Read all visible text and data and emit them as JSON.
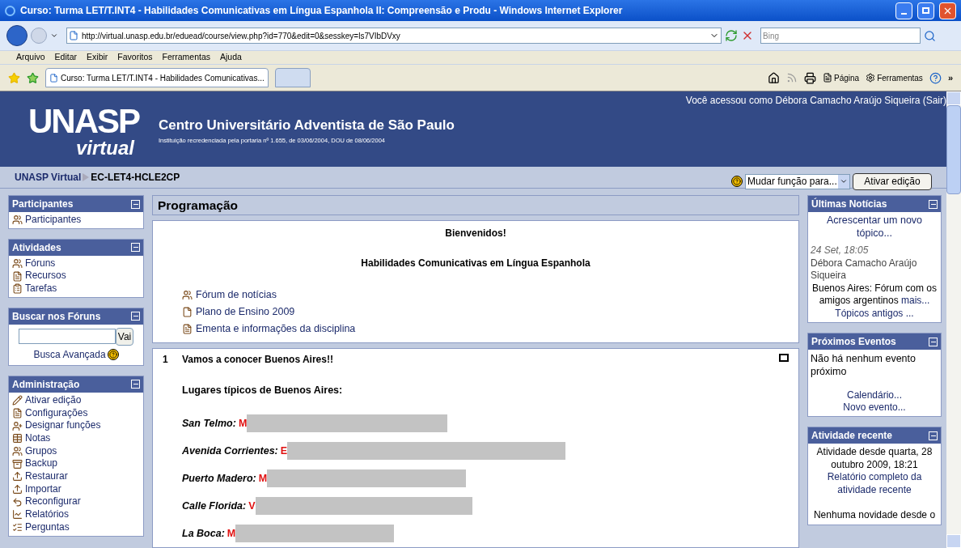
{
  "window": {
    "title": "Curso: Turma LET/T.INT4 - Habilidades Comunicativas em Língua Espanhola II: Compreensão e Produ - Windows Internet Explorer"
  },
  "address_bar": {
    "url": "http://virtual.unasp.edu.br/eduead/course/view.php?id=770&edit=0&sesskey=ls7VIbDVxy",
    "search_placeholder": "Bing"
  },
  "menu": [
    "Arquivo",
    "Editar",
    "Exibir",
    "Favoritos",
    "Ferramentas",
    "Ajuda"
  ],
  "tabs": [
    {
      "label": "Curso: Turma LET/T.INT4 - Habilidades Comunicativas...",
      "selected": true
    },
    {
      "selected": false
    }
  ],
  "command_bar": [
    "Página",
    "Ferramentas",
    "»"
  ],
  "header": {
    "logo_top": "UNASP",
    "logo_bottom": "virtual",
    "title": "Centro Universitário Adventista de São Paulo",
    "subtitle": "Instituição recredenciada pela portaria nº 1.655, de 03/06/2004, DOU de 08/06/2004",
    "login": "Você acessou como Débora Camacho Araújo Siqueira (Sair)"
  },
  "breadcrumb": {
    "items": [
      "UNASP Virtual",
      "EC-LET4-HCLE2CP"
    ],
    "role_select": "Mudar função para...",
    "edit_button": "Ativar edição"
  },
  "left_blocks": [
    {
      "title": "Participantes",
      "kind": "list",
      "items": [
        "Participantes"
      ]
    },
    {
      "title": "Atividades",
      "kind": "list",
      "items": [
        "Fóruns",
        "Recursos",
        "Tarefas"
      ]
    },
    {
      "title": "Buscar nos Fóruns",
      "kind": "search",
      "button": "Vai",
      "link": "Busca Avançada"
    },
    {
      "title": "Administração",
      "kind": "list",
      "items": [
        "Ativar edição",
        "Configurações",
        "Designar funções",
        "Notas",
        "Grupos",
        "Backup",
        "Restaurar",
        "Importar",
        "Reconfigurar",
        "Relatórios",
        "Perguntas"
      ]
    }
  ],
  "main": {
    "title": "Programação",
    "intro": {
      "heading": "Bienvenidos!",
      "subheading": "Habilidades Comunicativas em Língua Espanhola",
      "links": [
        "Fórum de notícias",
        "Plano de Ensino 2009",
        "Ementa e informações da disciplina"
      ]
    },
    "topic": {
      "number": "1",
      "title": "Vamos a conocer Buenos Aires!!",
      "subheading": "Lugares típicos de Buenos Aires:",
      "places": [
        {
          "name": "San Telmo:",
          "initial": "M"
        },
        {
          "name": "Avenida Corrientes:",
          "initial": "E"
        },
        {
          "name": "Puerto Madero:",
          "initial": "M"
        },
        {
          "name": "Calle Florida:",
          "initial": "V"
        },
        {
          "name": "La Boca:",
          "initial": "M"
        }
      ]
    }
  },
  "right_blocks": [
    {
      "title": "Últimas Notícias",
      "kind": "news",
      "add_link": "Acrescentar um novo tópico...",
      "date": "24 Set, 18:05",
      "author": "Débora Camacho Araújo Siqueira",
      "text": "Buenos Aires: Fórum com os amigos argentinos",
      "more": "mais...",
      "older": "Tópicos antigos ..."
    },
    {
      "title": "Próximos Eventos",
      "kind": "events",
      "text": "Não há nenhum evento próximo",
      "links": [
        "Calendário...",
        "Novo evento..."
      ]
    },
    {
      "title": "Atividade recente",
      "kind": "activity",
      "text": "Atividade desde quarta, 28 outubro 2009, 18:21",
      "link": "Relatório completo da atividade recente",
      "note": "Nenhuma novidade desde o"
    }
  ]
}
